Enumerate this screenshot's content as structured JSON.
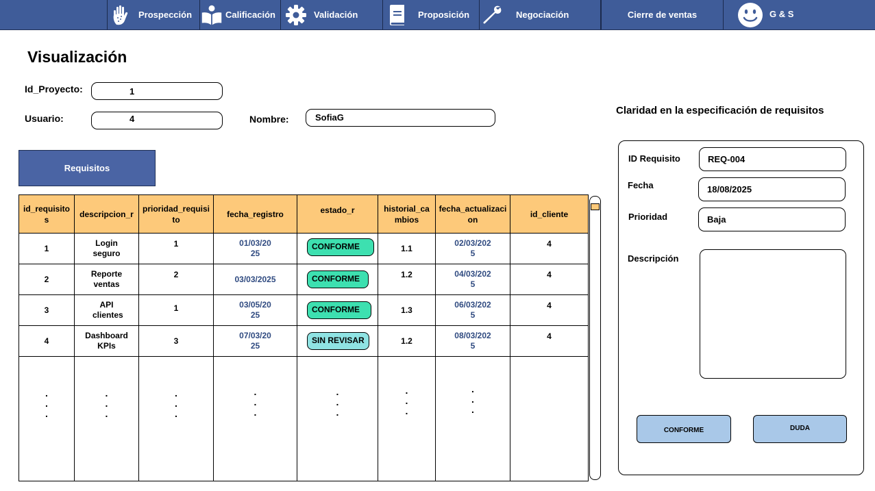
{
  "nav": {
    "items": [
      {
        "label": "Prospección",
        "icon": "hand-icon"
      },
      {
        "label": "Calificación",
        "icon": "reader-icon"
      },
      {
        "label": "Validación",
        "icon": "gear-icon"
      },
      {
        "label": "Proposición",
        "icon": "document-icon"
      },
      {
        "label": "Negociación",
        "icon": "wrench-icon"
      },
      {
        "label": "Cierre de ventas",
        "icon": ""
      }
    ],
    "user": {
      "label": "G & S",
      "icon": "smiley-icon"
    }
  },
  "page": {
    "title": "Visualización"
  },
  "form": {
    "id_proyecto_label": "Id_Proyecto:",
    "id_proyecto_value": "1",
    "usuario_label": "Usuario:",
    "usuario_value": "4",
    "nombre_label": "Nombre:",
    "nombre_value": "SofiaG"
  },
  "requisitos_tab": "Requisitos",
  "table": {
    "headers": [
      "id_requisitos",
      "descripcion_r",
      "prioridad_requisito",
      "fecha_registro",
      "estado_r",
      "historial_cambios",
      "fecha_actualizacion",
      "id_cliente"
    ],
    "rows": [
      {
        "id": "1",
        "descripcion": "Login seguro",
        "prioridad": "1",
        "fecha_registro": "01/03/2025",
        "estado": "CONFORME",
        "historial": "1.1",
        "fecha_actualizacion": "02/03/2025",
        "id_cliente": "4"
      },
      {
        "id": "2",
        "descripcion": "Reporte ventas",
        "prioridad": "2",
        "fecha_registro": "03/03/2025",
        "estado": "CONFORME",
        "historial": "1.2",
        "fecha_actualizacion": "04/03/2025",
        "id_cliente": "4"
      },
      {
        "id": "3",
        "descripcion": "API clientes",
        "prioridad": "1",
        "fecha_registro": "03/05/2025",
        "estado": "CONFORME",
        "historial": "1.3",
        "fecha_actualizacion": "06/03/2025",
        "id_cliente": "4"
      },
      {
        "id": "4",
        "descripcion": "Dashboard KPIs",
        "prioridad": "3",
        "fecha_registro": "07/03/2025",
        "estado": "SIN REVISAR",
        "historial": "1.2",
        "fecha_actualizacion": "08/03/2025",
        "id_cliente": "4"
      }
    ],
    "continuation": ".\n.\n."
  },
  "colors": {
    "nav_bg": "#3f5c99",
    "header_bg": "#fdc97a",
    "conforme": "#3de0b0",
    "sin_revisar": "#8fe3e3",
    "button_bg": "#a9c8e8",
    "date_text": "#2f4a80"
  },
  "panel": {
    "title": "Claridad en la especificación de requisitos",
    "id_label": "ID Requisito",
    "id_value": "REQ-004",
    "fecha_label": "Fecha",
    "fecha_value": "18/08/2025",
    "prioridad_label": "Prioridad",
    "prioridad_value": "Baja",
    "descripcion_label": "Descripción",
    "descripcion_value": "",
    "conforme_button": "CONFORME",
    "duda_button": "DUDA"
  }
}
